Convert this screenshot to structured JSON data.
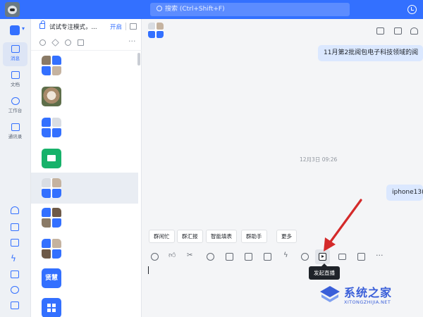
{
  "titlebar": {
    "search_placeholder": "搜索 (Ctrl+Shift+F)",
    "accent_color": "#3370ff"
  },
  "rail": {
    "items": [
      {
        "label": "消息",
        "icon": "message-icon",
        "active": true
      },
      {
        "label": "文档",
        "icon": "doc-icon"
      },
      {
        "label": "工作台",
        "icon": "workbench-icon"
      },
      {
        "label": "通讯录",
        "icon": "contacts-icon"
      }
    ],
    "bottom_icons": [
      "cloud-icon",
      "calendar-icon",
      "todo-icon",
      "flash-icon",
      "mail-icon",
      "phone-icon",
      "clipboard-icon"
    ]
  },
  "convlist": {
    "focus_mode_label": "试试专注模式，...",
    "focus_mode_action": "开启",
    "filter_icons": [
      "at-icon",
      "star-icon",
      "clock-icon",
      "doc-icon"
    ],
    "items": [
      {
        "type": "group-grid"
      },
      {
        "type": "dog-avatar"
      },
      {
        "type": "group-grid"
      },
      {
        "type": "folder-avatar"
      },
      {
        "type": "group-grid",
        "active": true
      },
      {
        "type": "group-grid"
      },
      {
        "type": "group-grid"
      },
      {
        "type": "text-avatar",
        "text": "贤慧"
      },
      {
        "type": "apps-avatar"
      }
    ]
  },
  "chat": {
    "header_icons": [
      "video-icon",
      "task-icon",
      "pin-icon"
    ],
    "messages": [
      {
        "text": "11月第2批阅包电子科技领域的阅"
      },
      {
        "text": "iphone13("
      }
    ],
    "timestamp": "12月3日 09:26",
    "tool_tabs": [
      "群闲忙",
      "群汇报",
      "智能填表",
      "群助手",
      "更多"
    ],
    "toolbar_icons": [
      "emoji-icon",
      "thumbs-up-icon",
      "scissors-icon",
      "at-icon",
      "add-folder-icon",
      "calendar-icon",
      "todo-icon",
      "flash-icon",
      "phone-icon",
      "live-stream-icon",
      "mail-icon",
      "screen-share-icon",
      "more-icon"
    ],
    "tooltip": "发起直播"
  },
  "watermark": {
    "title": "系统之家",
    "subtitle": "XITONGZHIJIA.NET"
  }
}
